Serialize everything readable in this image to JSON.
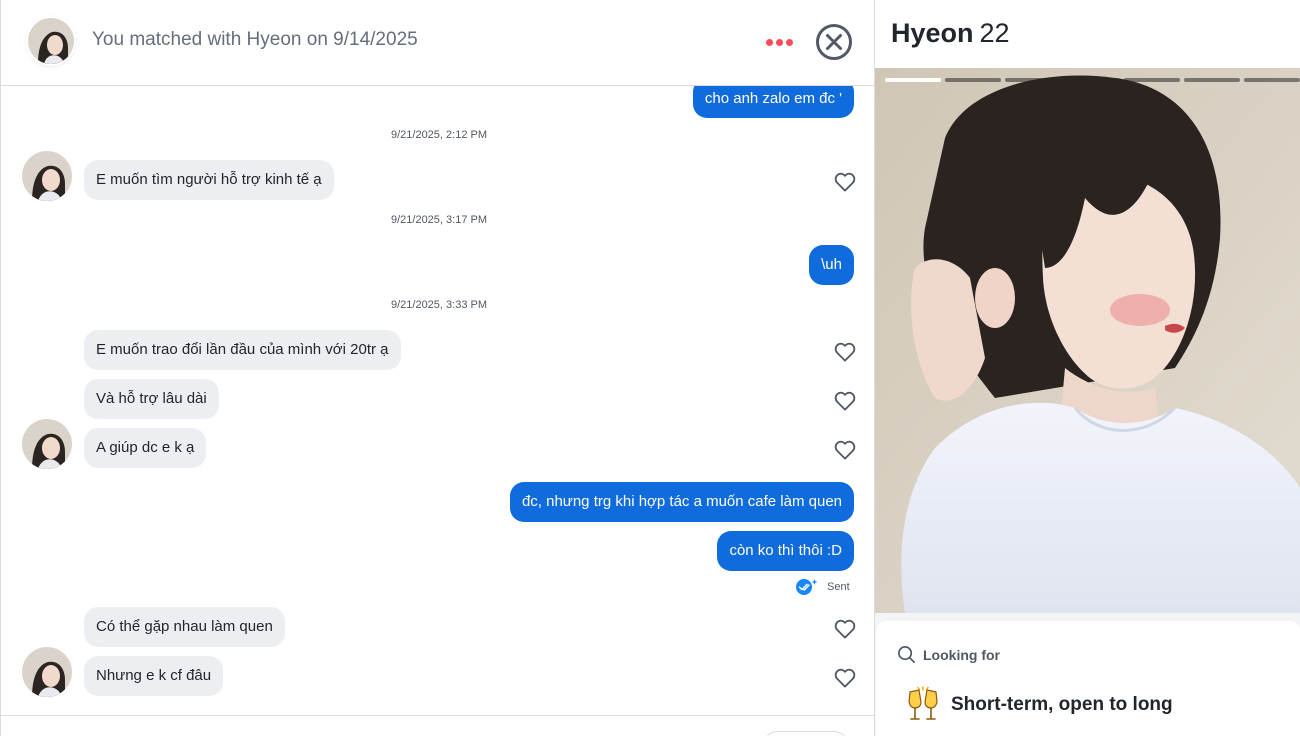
{
  "header": {
    "match_text": "You matched with Hyeon on 9/14/2025"
  },
  "colors": {
    "accent_red": "#fd4b5c",
    "outgoing_bubble": "#106bdc",
    "incoming_bubble": "#eceef1",
    "sent_check": "#1786ff"
  },
  "icons": {
    "more": "more-dots-icon",
    "close": "close-circle-icon",
    "like": "heart-icon",
    "sent": "double-check-icon",
    "search": "search-icon",
    "looking_for": "clinking-glasses-icon"
  },
  "messages": [
    {
      "direction": "out",
      "text": "cho anh zalo em đc '"
    },
    {
      "type": "timestamp",
      "text": "9/21/2025, 2:12 PM"
    },
    {
      "direction": "in",
      "text": "E muốn tìm người hỗ trợ kinh tế ạ"
    },
    {
      "type": "timestamp",
      "text": "9/21/2025, 3:17 PM"
    },
    {
      "direction": "out",
      "text": "\\uh"
    },
    {
      "type": "timestamp",
      "text": "9/21/2025, 3:33 PM"
    },
    {
      "direction": "in",
      "text": "E muốn trao đổi lần đầu của mình với 20tr ạ"
    },
    {
      "direction": "in",
      "text": "Và hỗ trợ lâu dài"
    },
    {
      "direction": "in",
      "text": "A giúp dc e k ạ"
    },
    {
      "direction": "out",
      "text": "đc, nhưng trg khi hợp tác a muốn cafe làm quen"
    },
    {
      "direction": "out",
      "text": "còn ko thì thôi :D"
    },
    {
      "direction": "in",
      "text": "Có thể gặp nhau làm quen"
    },
    {
      "direction": "in",
      "text": "Nhưng e k cf đâu"
    }
  ],
  "status": {
    "sent_label": "Sent"
  },
  "profile": {
    "name": "Hyeon",
    "age": "22",
    "photo_count": 7,
    "photo_index": 1,
    "looking_for_label": "Looking for",
    "looking_for_value": "Short-term, open to long"
  }
}
